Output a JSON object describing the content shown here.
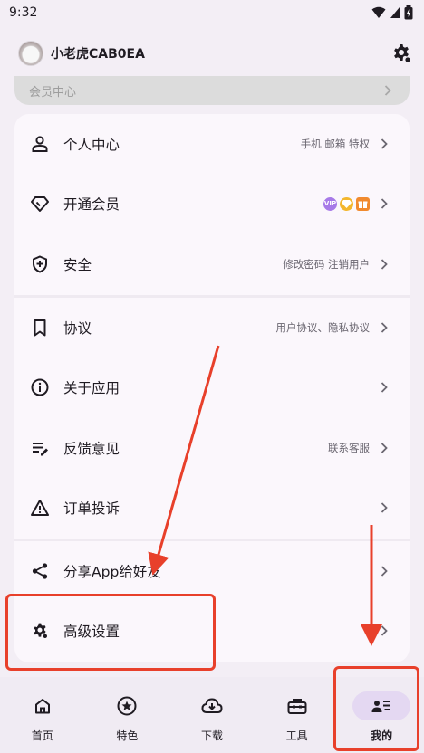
{
  "status_bar": {
    "time": "9:32"
  },
  "header": {
    "username": "小老虎CAB0EA"
  },
  "member_card": {
    "label": "会员中心"
  },
  "menu": [
    {
      "id": "personal",
      "label": "个人中心",
      "hint": "手机 邮箱 特权",
      "icon": "person-icon"
    },
    {
      "id": "vip",
      "label": "开通会员",
      "hint": "",
      "icon": "diamond-icon"
    },
    {
      "id": "security",
      "label": "安全",
      "hint": "修改密码 注销用户",
      "icon": "shield-icon"
    },
    {
      "id": "agreement",
      "label": "协议",
      "hint": "用户协议、隐私协议",
      "icon": "bookmark-icon"
    },
    {
      "id": "about",
      "label": "关于应用",
      "hint": "",
      "icon": "info-icon"
    },
    {
      "id": "feedback",
      "label": "反馈意见",
      "hint": "联系客服",
      "icon": "feedback-icon"
    },
    {
      "id": "complaint",
      "label": "订单投诉",
      "hint": "",
      "icon": "warning-icon"
    },
    {
      "id": "share",
      "label": "分享App给好友",
      "hint": "",
      "icon": "share-icon"
    },
    {
      "id": "advanced",
      "label": "高级设置",
      "hint": "",
      "icon": "gear-icon"
    }
  ],
  "vip_badges": [
    "VIP",
    "",
    ""
  ],
  "colors": {
    "accent": "#e4d8f2",
    "annotation": "#e8402b",
    "background": "#f3eef5",
    "card": "#fbf7fc"
  },
  "bottom_nav": [
    {
      "label": "首页",
      "icon": "home-icon",
      "active": false
    },
    {
      "label": "特色",
      "icon": "star-icon",
      "active": false
    },
    {
      "label": "下载",
      "icon": "download-cloud-icon",
      "active": false
    },
    {
      "label": "工具",
      "icon": "toolbox-icon",
      "active": false
    },
    {
      "label": "我的",
      "icon": "profile-list-icon",
      "active": true
    }
  ]
}
